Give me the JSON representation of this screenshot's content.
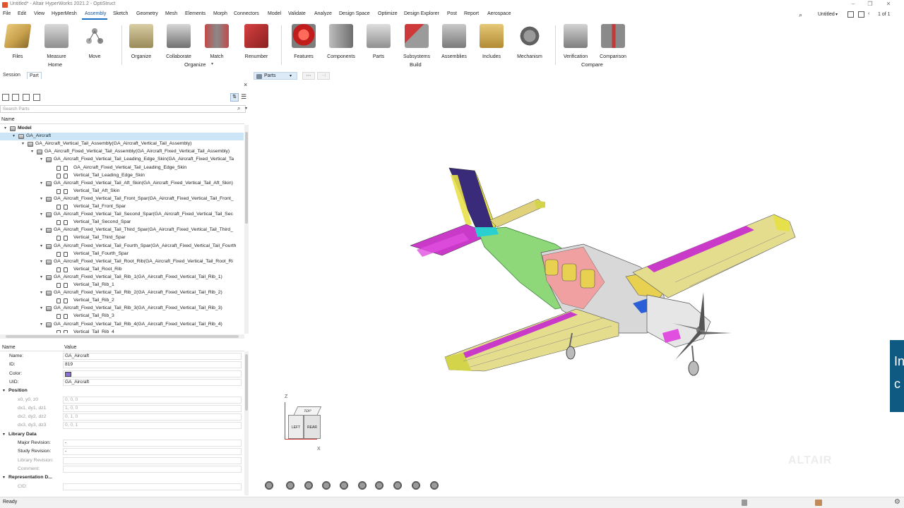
{
  "window": {
    "title": "Untitled* - Altair HyperWorks 2021.2 - OptiStruct",
    "controls": [
      "–",
      "❐",
      "✕"
    ]
  },
  "menu": {
    "items": [
      "File",
      "Edit",
      "View",
      "HyperMesh",
      "Assembly",
      "Sketch",
      "Geometry",
      "Mesh",
      "Elements",
      "Morph",
      "Connectors",
      "Model",
      "Validate",
      "Analyze",
      "Design Space",
      "Optimize",
      "Design Explorer",
      "Post",
      "Report",
      "Aerospace"
    ],
    "active": "Assembly",
    "doc_name": "Untitled",
    "page_counter": "1 of 1"
  },
  "ribbon": {
    "tools": [
      {
        "label": "Files",
        "icon": "files-icon"
      },
      {
        "label": "Measure",
        "icon": "measure-icon"
      },
      {
        "label": "Move",
        "icon": "move-icon"
      },
      {
        "label": "Organize",
        "icon": "organize-icon"
      },
      {
        "label": "Collaborate",
        "icon": "collaborate-icon"
      },
      {
        "label": "Match",
        "icon": "match-icon"
      },
      {
        "label": "Renumber",
        "icon": "renumber-icon"
      },
      {
        "label": "Features",
        "icon": "features-icon"
      },
      {
        "label": "Components",
        "icon": "components-icon"
      },
      {
        "label": "Parts",
        "icon": "parts-icon"
      },
      {
        "label": "Subsystems",
        "icon": "subsystems-icon"
      },
      {
        "label": "Assemblies",
        "icon": "assemblies-icon"
      },
      {
        "label": "Includes",
        "icon": "includes-icon"
      },
      {
        "label": "Mechanism",
        "icon": "mechanism-icon"
      },
      {
        "label": "Verification",
        "icon": "verification-icon"
      },
      {
        "label": "Comparison",
        "icon": "comparison-icon"
      }
    ],
    "groups": [
      "Home",
      "Organize",
      "Build",
      "Compare"
    ]
  },
  "left_panel": {
    "tabs": [
      "Session",
      "Part"
    ],
    "active_tab": "Part",
    "search_placeholder": "Search Parts",
    "tree_column": "Name",
    "tree": [
      {
        "label": "Model",
        "depth": 0,
        "bold": true,
        "expand": "▾"
      },
      {
        "label": "GA_Aircraft",
        "depth": 1,
        "expand": "▾",
        "selected": true
      },
      {
        "label": "GA_Aircraft_Vertical_Tail_Assembly(GA_Aircraft_Vertical_Tail_Assembly)",
        "depth": 2,
        "expand": "▾"
      },
      {
        "label": "GA_Aircraft_Fixed_Vertical_Tail_Assembly(GA_Aircraft_Fixed_Vertical_Tail_Assembly)",
        "depth": 3,
        "expand": "▾"
      },
      {
        "label": "GA_Aircraft_Fixed_Vertical_Tail_Leading_Edge_Skin(GA_Aircraft_Fixed_Vertical_Ta",
        "depth": 4,
        "expand": "▾"
      },
      {
        "label": "GA_Aircraft_Fixed_Vertical_Tail_Leading_Edge_Skin",
        "depth": 5,
        "sub": true
      },
      {
        "label": "Vertical_Tail_Leading_Edge_Skin",
        "depth": 5,
        "sub": true
      },
      {
        "label": "GA_Aircraft_Fixed_Vertical_Tail_Aft_Skin(GA_Aircraft_Fixed_Vertical_Tail_Aft_Skin)",
        "depth": 4,
        "expand": "▾"
      },
      {
        "label": "Vertical_Tail_Aft_Skin",
        "depth": 5,
        "sub": true
      },
      {
        "label": "GA_Aircraft_Fixed_Vertical_Tail_Front_Spar(GA_Aircraft_Fixed_Vertical_Tail_Front_",
        "depth": 4,
        "expand": "▾"
      },
      {
        "label": "Vertical_Tail_Front_Spar",
        "depth": 5,
        "sub": true
      },
      {
        "label": "GA_Aircraft_Fixed_Vertical_Tail_Second_Spar(GA_Aircraft_Fixed_Vertical_Tail_Sec",
        "depth": 4,
        "expand": "▾"
      },
      {
        "label": "Vertical_Tail_Second_Spar",
        "depth": 5,
        "sub": true
      },
      {
        "label": "GA_Aircraft_Fixed_Vertical_Tail_Third_Spar(GA_Aircraft_Fixed_Vertical_Tail_Third_",
        "depth": 4,
        "expand": "▾"
      },
      {
        "label": "Vertical_Tail_Third_Spar",
        "depth": 5,
        "sub": true
      },
      {
        "label": "GA_Aircraft_Fixed_Vertical_Tail_Fourth_Spar(GA_Aircraft_Fixed_Vertical_Tail_Fourth",
        "depth": 4,
        "expand": "▾"
      },
      {
        "label": "Vertical_Tail_Fourth_Spar",
        "depth": 5,
        "sub": true
      },
      {
        "label": "GA_Aircraft_Fixed_Vertical_Tail_Root_Rib(GA_Aircraft_Fixed_Vertical_Tail_Root_Ri",
        "depth": 4,
        "expand": "▾"
      },
      {
        "label": "Vertical_Tail_Root_Rib",
        "depth": 5,
        "sub": true
      },
      {
        "label": "GA_Aircraft_Fixed_Vertical_Tail_Rib_1(GA_Aircraft_Fixed_Vertical_Tail_Rib_1)",
        "depth": 4,
        "expand": "▾"
      },
      {
        "label": "Vertical_Tail_Rib_1",
        "depth": 5,
        "sub": true
      },
      {
        "label": "GA_Aircraft_Fixed_Vertical_Tail_Rib_2(GA_Aircraft_Fixed_Vertical_Tail_Rib_2)",
        "depth": 4,
        "expand": "▾"
      },
      {
        "label": "Vertical_Tail_Rib_2",
        "depth": 5,
        "sub": true
      },
      {
        "label": "GA_Aircraft_Fixed_Vertical_Tail_Rib_3(GA_Aircraft_Fixed_Vertical_Tail_Rib_3)",
        "depth": 4,
        "expand": "▾"
      },
      {
        "label": "Vertical_Tail_Rib_3",
        "depth": 5,
        "sub": true
      },
      {
        "label": "GA_Aircraft_Fixed_Vertical_Tail_Rib_4(GA_Aircraft_Fixed_Vertical_Tail_Rib_4)",
        "depth": 4,
        "expand": "▾"
      },
      {
        "label": "Vertical_Tail_Rib_4",
        "depth": 5,
        "sub": true
      }
    ],
    "properties": {
      "header_name": "Name",
      "header_value": "Value",
      "rows": [
        {
          "key": "Name:",
          "value": "GA_Aircraft"
        },
        {
          "key": "ID:",
          "value": "819"
        },
        {
          "key": "Color:",
          "value": "",
          "swatch": "#8a6fd8"
        },
        {
          "key": "UID:",
          "value": "GA_Aircraft"
        },
        {
          "key": "Position",
          "section": true
        },
        {
          "key": "x0, y0, z0",
          "value": "0, 0, 0",
          "dim": true
        },
        {
          "key": "dx1, dy1, dz1",
          "value": "1, 0, 0",
          "dim": true
        },
        {
          "key": "dx2, dy2, dz2",
          "value": "0, 1, 0",
          "dim": true
        },
        {
          "key": "dx3, dy3, dz3",
          "value": "0, 0, 1",
          "dim": true
        },
        {
          "key": "Library Data",
          "section": true
        },
        {
          "key": "Major Revision:",
          "value": "-"
        },
        {
          "key": "Study Revision:",
          "value": "-"
        },
        {
          "key": "Library Revision:",
          "value": "",
          "dim": true
        },
        {
          "key": "Comment:",
          "value": "",
          "dim": true
        },
        {
          "key": "Representation D...",
          "section": true
        },
        {
          "key": "CID:",
          "value": "",
          "dim": true
        }
      ]
    }
  },
  "viewport": {
    "entity_selector": "Parts",
    "more_label": "⋯",
    "axis_labels": {
      "z": "Z",
      "x": "X"
    },
    "viewcube": {
      "top": "TOP",
      "left": "LEFT",
      "rear": "REAR"
    },
    "banner_text": "In\nc",
    "watermark": "ALTAIR",
    "tools": [
      "view-icon",
      "rotate-icon",
      "pan-icon",
      "fit-icon",
      "section-icon",
      "focus-icon",
      "axis-icon",
      "zoom-icon",
      "zoom-area-icon",
      "lock-icon"
    ]
  },
  "status": {
    "text": "Ready"
  },
  "colors": {
    "accent": "#1a6fc4",
    "selection": "#cde6f7",
    "banner": "#0e5a82"
  }
}
